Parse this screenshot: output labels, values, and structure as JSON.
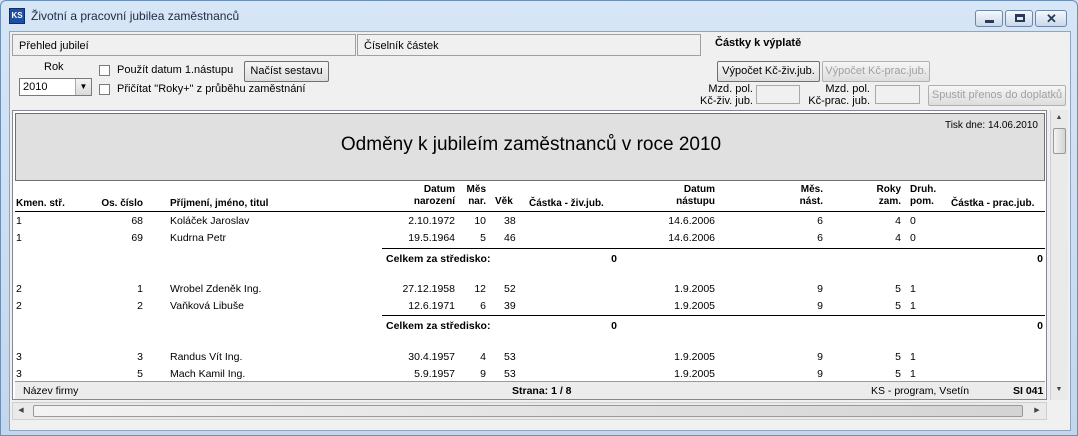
{
  "window": {
    "title": "Životní a pracovní jubilea zaměstnanců"
  },
  "tabs": [
    "Přehled jubileí",
    "Číselník částek",
    "Částky k výplatě"
  ],
  "controls": {
    "rok_label": "Rok",
    "rok_value": "2010",
    "check1": "Použít datum 1.nástupu",
    "check2": "Přičítat \"Roky+\" z průběhu zaměstnání",
    "load_button": "Načíst sestavu",
    "calc_ziv": "Výpočet Kč-živ.jub.",
    "calc_prac": "Výpočet Kč-prac.jub.",
    "mzd_ziv_1": "Mzd. pol.",
    "mzd_ziv_2": "Kč-živ. jub.",
    "mzd_prac_1": "Mzd. pol.",
    "mzd_prac_2": "Kč-prac. jub.",
    "transfer_button": "Spustit přenos do doplatků"
  },
  "report": {
    "title": "Odměny k jubileím zaměstnanců v roce 2010",
    "print_date": "Tisk dne: 14.06.2010",
    "headers": {
      "kmen": "Kmen. stř.",
      "os": "Os. číslo",
      "jmeno": "Příjmení, jméno, titul",
      "datum_nar_1": "Datum",
      "datum_nar_2": "narození",
      "mes_nar_1": "Měs",
      "mes_nar_2": "nar.",
      "vek": "Věk",
      "castka_ziv": "Částka - živ.jub.",
      "datum_nast_1": "Datum",
      "datum_nast_2": "nástupu",
      "mes_nast_1": "Měs.",
      "mes_nast_2": "nást.",
      "roky_1": "Roky",
      "roky_2": "zam.",
      "druh_1": "Druh.",
      "druh_2": "pom.",
      "castka_prac": "Částka - prac.jub."
    },
    "rows": [
      {
        "kmen": "1",
        "os": "68",
        "jmeno": "Koláček Jaroslav",
        "dnar": "2.10.1972",
        "mnar": "10",
        "vek": "38",
        "dnast": "14.6.2006",
        "mnast": "6",
        "roky": "4",
        "druh": "0"
      },
      {
        "kmen": "1",
        "os": "69",
        "jmeno": "Kudrna Petr",
        "dnar": "19.5.1964",
        "mnar": "5",
        "vek": "46",
        "dnast": "14.6.2006",
        "mnast": "6",
        "roky": "4",
        "druh": "0"
      },
      {
        "kmen": "2",
        "os": "1",
        "jmeno": "Wrobel Zdeněk Ing.",
        "dnar": "27.12.1958",
        "mnar": "12",
        "vek": "52",
        "dnast": "1.9.2005",
        "mnast": "9",
        "roky": "5",
        "druh": "1"
      },
      {
        "kmen": "2",
        "os": "2",
        "jmeno": "Vaňková Libuše",
        "dnar": "12.6.1971",
        "mnar": "6",
        "vek": "39",
        "dnast": "1.9.2005",
        "mnast": "9",
        "roky": "5",
        "druh": "1"
      },
      {
        "kmen": "3",
        "os": "3",
        "jmeno": "Randus Vít Ing.",
        "dnar": "30.4.1957",
        "mnar": "4",
        "vek": "53",
        "dnast": "1.9.2005",
        "mnast": "9",
        "roky": "5",
        "druh": "1"
      },
      {
        "kmen": "3",
        "os": "5",
        "jmeno": "Mach Kamil Ing.",
        "dnar": "5.9.1957",
        "mnar": "9",
        "vek": "53",
        "dnast": "1.9.2005",
        "mnast": "9",
        "roky": "5",
        "druh": "1"
      }
    ],
    "subtotal_label": "Celkem za středisko:",
    "subtotal_ziv": "0",
    "subtotal_prac": "0",
    "footer": {
      "company": "Název firmy",
      "page": "Strana: 1 / 8",
      "program": "KS - program, Vsetín",
      "code": "SI 041"
    }
  }
}
